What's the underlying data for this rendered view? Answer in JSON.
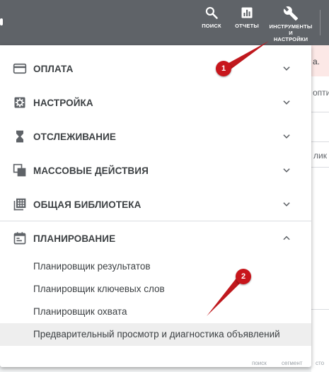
{
  "topbar": {
    "search_label": "ПОИСК",
    "reports_label": "ОТЧЕТЫ",
    "tools_label_line1": "ИНСТРУМЕНТЫ",
    "tools_label_line2": "И",
    "tools_label_line3": "НАСТРОЙКИ",
    "search_icon": "search-icon",
    "reports_icon": "bar-chart-icon",
    "tools_icon": "wrench-icon"
  },
  "background": {
    "alert_fragment": "а.",
    "col_fragment": "опти",
    "col_fragment_2": "лик",
    "footer_search": "поиск",
    "footer_segment": "сегмент",
    "footer_columns": "сто"
  },
  "menu": {
    "sections": [
      {
        "label": "ОПЛАТА",
        "icon": "credit-card-icon",
        "expanded": false
      },
      {
        "label": "НАСТРОЙКА",
        "icon": "gear-icon",
        "expanded": false
      },
      {
        "label": "ОТСЛЕЖИВАНИЕ",
        "icon": "hourglass-icon",
        "expanded": false
      },
      {
        "label": "МАССОВЫЕ ДЕЙСТВИЯ",
        "icon": "copy-stack-icon",
        "expanded": false
      },
      {
        "label": "ОБЩАЯ БИБЛИОТЕКА",
        "icon": "grid-library-icon",
        "expanded": false
      },
      {
        "label": "ПЛАНИРОВАНИЕ",
        "icon": "calendar-icon",
        "expanded": true
      }
    ],
    "planning_items": [
      "Планировщик результатов",
      "Планировщик ключевых слов",
      "Планировщик охвата",
      "Предварительный просмотр и диагностика объявлений"
    ]
  },
  "annotations": {
    "badge_1": "1",
    "badge_2": "2",
    "accent_color": "#c8161c"
  }
}
